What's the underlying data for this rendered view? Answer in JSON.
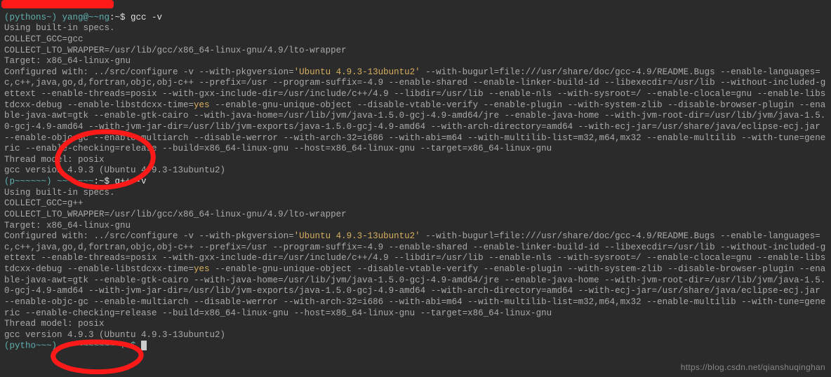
{
  "prompt1": {
    "user_host_hidden": "(pythons~) yang@~~ng",
    "cwd": ":~$ ",
    "cmd": "gcc -v"
  },
  "gcc": {
    "specs": "Using built-in specs.",
    "collect_gcc": "COLLECT_GCC=gcc",
    "lto_wrapper": "COLLECT_LTO_WRAPPER=/usr/lib/gcc/x86_64-linux-gnu/4.9/lto-wrapper",
    "target": "Target: x86_64-linux-gnu",
    "configured_prefix": "Configured with: ../src/configure -v --with-pkgversion=",
    "pkgversion": "'Ubuntu 4.9.3-13ubuntu2'",
    "config_after_pkg": " --with-bugurl=file:///usr/share/doc/gcc-4.9/README.Bugs --enable-languages=c,c++,java,go,d,fortran,objc,obj-c++ --prefix=/usr --program-suffix=-4.9 --enable-shared --enable-linker-build-id --libexecdir=/usr/lib --without-included-gettext --enable-threads=posix --with-gxx-include-dir=/usr/include/c++/4.9 --libdir=/usr/lib --enable-nls --with-sysroot=/ --enable-clocale=gnu --enable-libstdcxx-debug --enable-libstdcxx-time=",
    "yes": "yes",
    "config_after_yes": " --enable-gnu-unique-object --disable-vtable-verify --enable-plugin --with-system-zlib --disable-browser-plugin --enable-java-awt=gtk --enable-gtk-cairo --with-java-home=/usr/lib/jvm/java-1.5.0-gcj-4.9-amd64/jre --enable-java-home --with-jvm-root-dir=/usr/lib/jvm/java-1.5.0-gcj-4.9-amd64 --with-jvm-jar-dir=/usr/lib/jvm-exports/java-1.5.0-gcj-4.9-amd64 --with-arch-directory=amd64 --with-ecj-jar=/usr/share/java/eclipse-ecj.jar --enable-objc-gc --enable-multiarch --disable-werror --with-arch-32=i686 --with-abi=m64 --with-multilib-list=m32,m64,mx32 --enable-multilib --with-tune=generic --enable-checking=release --build=x86_64-linux-gnu --host=x86_64-linux-gnu --target=x86_64-linux-gnu",
    "thread_model": "Thread model: posix",
    "version": "gcc version 4.9.3 (Ubuntu 4.9.3-13ubuntu2)"
  },
  "prompt2": {
    "user_host_hidden": "(p~~~~~~) ~~~~~~~",
    "cwd": ":~$ ",
    "cmd": "g++ -v"
  },
  "gpp": {
    "specs": "Using built-in specs.",
    "collect_gcc": "COLLECT_GCC=g++",
    "lto_wrapper": "COLLECT_LTO_WRAPPER=/usr/lib/gcc/x86_64-linux-gnu/4.9/lto-wrapper",
    "target": "Target: x86_64-linux-gnu",
    "configured_prefix": "Configured with: ../src/configure -v --with-pkgversion=",
    "pkgversion": "'Ubuntu 4.9.3-13ubuntu2'",
    "config_after_pkg": " --with-bugurl=file:///usr/share/doc/gcc-4.9/README.Bugs --enable-languages=c,c++,java,go,d,fortran,objc,obj-c++ --prefix=/usr --program-suffix=-4.9 --enable-shared --enable-linker-build-id --libexecdir=/usr/lib --without-included-gettext --enable-threads=posix --with-gxx-include-dir=/usr/include/c++/4.9 --libdir=/usr/lib --enable-nls --with-sysroot=/ --enable-clocale=gnu --enable-libstdcxx-debug --enable-libstdcxx-time=",
    "yes": "yes",
    "config_after_yes": " --enable-gnu-unique-object --disable-vtable-verify --enable-plugin --with-system-zlib --disable-browser-plugin --enable-java-awt=gtk --enable-gtk-cairo --with-java-home=/usr/lib/jvm/java-1.5.0-gcj-4.9-amd64/jre --enable-java-home --with-jvm-root-dir=/usr/lib/jvm/java-1.5.0-gcj-4.9-amd64 --with-jvm-jar-dir=/usr/lib/jvm-exports/java-1.5.0-gcj-4.9-amd64 --with-arch-directory=amd64 --with-ecj-jar=/usr/share/java/eclipse-ecj.jar --enable-objc-gc --enable-multiarch --disable-werror --with-arch-32=i686 --with-abi=m64 --with-multilib-list=m32,m64,mx32 --enable-multilib --with-tune=generic --enable-checking=release --build=x86_64-linux-gnu --host=x86_64-linux-gnu --target=x86_64-linux-gnu",
    "thread_model": "Thread model: posix",
    "version": "gcc version 4.9.3 (Ubuntu 4.9.3-13ubuntu2)"
  },
  "prompt3": {
    "user_host_hidden": "(pytho~~~) ~~~~~~~~~~~:~$ "
  },
  "watermark": "https://blog.csdn.net/qianshuqinghan"
}
